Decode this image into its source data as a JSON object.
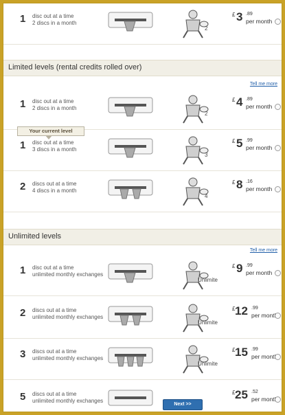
{
  "colors": {
    "frame": "#c9a227",
    "section_bg": "#f1efe6",
    "link": "#1f5ea8",
    "button": "#2f6fb0"
  },
  "top_plan": {
    "count": "1",
    "line1": "disc out at a time",
    "line2": "2 discs in a month",
    "mascot_label": "2",
    "currency": "£",
    "pounds": "3",
    "pence": ".89",
    "per": "per month"
  },
  "limited": {
    "title": "Limited levels (rental credits rolled over)",
    "tell_me_more": "Tell me more",
    "current_level_badge": "Your current level",
    "plans": [
      {
        "count": "1",
        "line1": "disc out at a time",
        "line2": "2 discs in a month",
        "mascot_label": "2",
        "currency": "£",
        "pounds": "4",
        "pence": ".89",
        "per": "per month"
      },
      {
        "count": "1",
        "line1": "disc out at a time",
        "line2": "3 discs in a month",
        "mascot_label": "3",
        "currency": "£",
        "pounds": "5",
        "pence": ".99",
        "per": "per month"
      },
      {
        "count": "2",
        "line1": "discs out at a time",
        "line2": "4 discs in a month",
        "mascot_label": "4",
        "currency": "£",
        "pounds": "8",
        "pence": ".16",
        "per": "per month"
      }
    ]
  },
  "unlimited": {
    "title": "Unlimited levels",
    "tell_me_more": "Tell me more",
    "plans": [
      {
        "count": "1",
        "line1": "disc out at a time",
        "line2": "unlimited monthly exchanges",
        "mascot_label": "Unlimite",
        "currency": "£",
        "pounds": "9",
        "pence": ".99",
        "per": "per month"
      },
      {
        "count": "2",
        "line1": "discs out at a time",
        "line2": "unlimited monthly exchanges",
        "mascot_label": "Unlimite",
        "currency": "£",
        "pounds": "12",
        "pence": ".99",
        "per": "per month"
      },
      {
        "count": "3",
        "line1": "discs out at a time",
        "line2": "unlimited monthly exchanges",
        "mascot_label": "Unlimite",
        "currency": "£",
        "pounds": "15",
        "pence": ".99",
        "per": "per month"
      },
      {
        "count": "5",
        "line1": "discs out at a time",
        "line2": "unlimited monthly exchanges",
        "mascot_label": "",
        "currency": "£",
        "pounds": "25",
        "pence": ".52",
        "per": "per month"
      }
    ]
  },
  "next_button": "Next >>"
}
